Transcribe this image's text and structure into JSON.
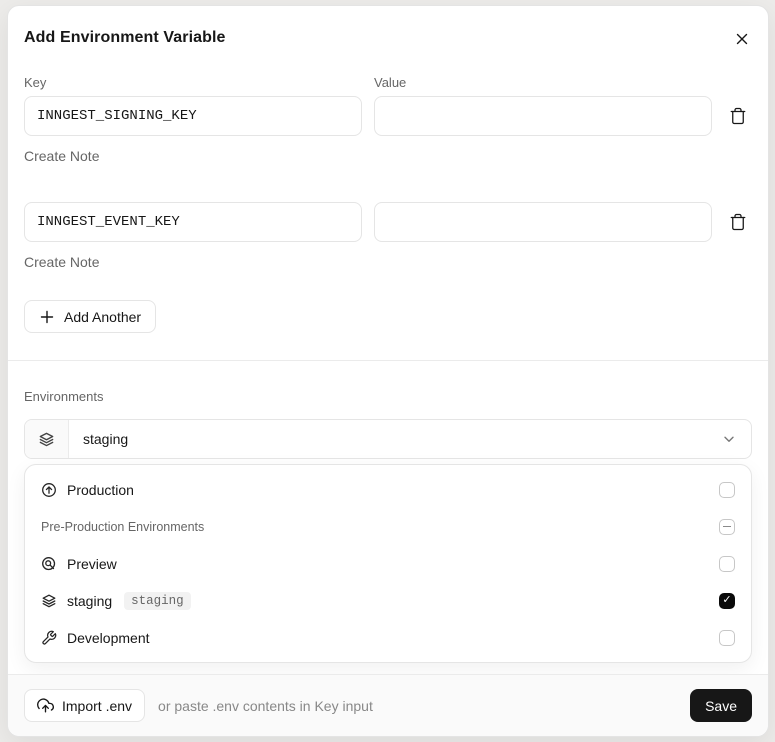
{
  "dialog": {
    "title": "Add Environment Variable"
  },
  "form": {
    "key_label": "Key",
    "value_label": "Value",
    "rows": [
      {
        "key_value": "INNGEST_SIGNING_KEY",
        "value_value": "",
        "note_label": "Create Note"
      },
      {
        "key_value": "INNGEST_EVENT_KEY",
        "value_value": "",
        "note_label": "Create Note"
      }
    ],
    "add_another_label": "Add Another"
  },
  "environments": {
    "label": "Environments",
    "selected_value": "staging",
    "options": [
      {
        "label": "Production",
        "icon": "production-icon",
        "checkbox": "unchecked"
      },
      {
        "label": "Pre-Production Environments",
        "group": true,
        "checkbox": "indeterminate"
      },
      {
        "label": "Preview",
        "icon": "preview-icon",
        "checkbox": "unchecked"
      },
      {
        "label": "staging",
        "icon": "staging-icon",
        "badge": "staging",
        "checkbox": "checked"
      },
      {
        "label": "Development",
        "icon": "development-icon",
        "checkbox": "unchecked"
      }
    ]
  },
  "footer": {
    "import_button_label": "Import .env",
    "hint_text": "or paste .env contents in Key input",
    "save_button_label": "Save"
  },
  "colors": {
    "accent_dark": "#171717",
    "border": "#e5e5e5",
    "muted_text": "#666666",
    "footer_bg": "#fafafa",
    "badge_bg": "#f2f2f2",
    "checkbox_checked": "#0a0a0a"
  }
}
